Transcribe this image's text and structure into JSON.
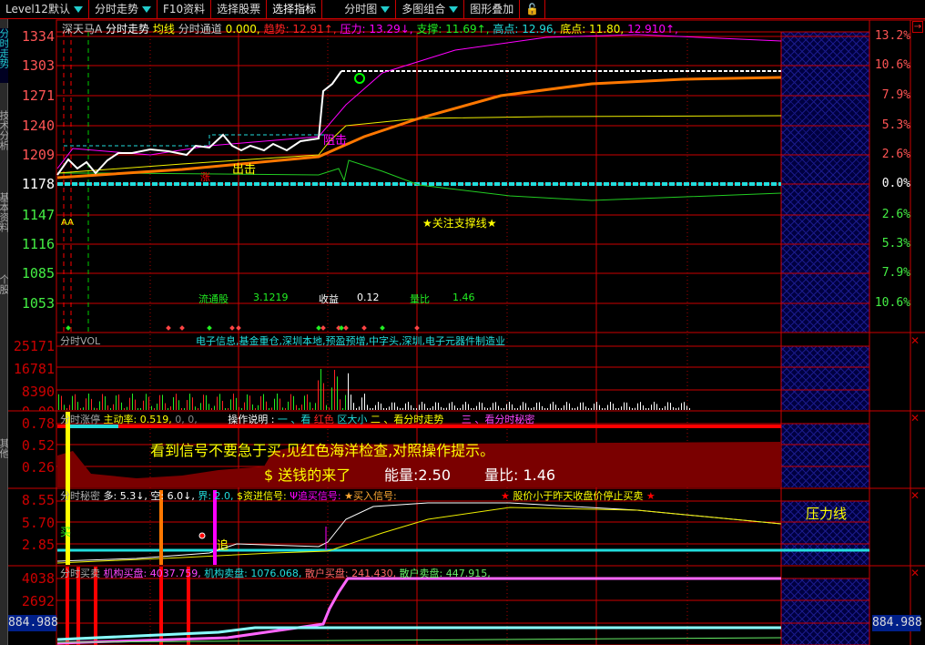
{
  "toolbar": {
    "items": [
      "Level12默认",
      "分时走势",
      "F10资料",
      "选择股票",
      "选择指标",
      "分时图",
      "多图组合",
      "图形叠加"
    ]
  },
  "sidebar": {
    "tabs": [
      "分时走势",
      "技术分析",
      "基本资料",
      "个股",
      "其他"
    ]
  },
  "main": {
    "stock": "深天马A",
    "mode": "分时走势",
    "ma": "均线",
    "channel_label": "分时通道",
    "channel_value": "0.000,",
    "trend": "趋势: 12.91↑,",
    "pressure": "压力: 13.29↓,",
    "support": "支撑: 11.69↑,",
    "high": "高点: 12.96,",
    "low": "底点: 11.80,",
    "extra": "12.910↑,",
    "left_axis": [
      "1334",
      "1303",
      "1271",
      "1240",
      "1209",
      "1178",
      "1147",
      "1116",
      "1085",
      "1053"
    ],
    "right_axis": [
      "13.2%",
      "10.6%",
      "7.9%",
      "5.3%",
      "2.6%",
      "0.0%",
      "2.6%",
      "5.3%",
      "7.9%",
      "10.6%"
    ],
    "labels": {
      "chuji": "出击",
      "zuji": "阻击",
      "zhang": "涨",
      "aa": "AA",
      "watch": "★关注支撑线★"
    },
    "stats": {
      "float_label": "流通股",
      "float_value": "3.1219",
      "eps_label": "收益",
      "eps_value": "0.12",
      "ratio_label": "量比",
      "ratio_value": "1.46"
    }
  },
  "vol": {
    "title": "分时VOL",
    "tags": "电子信息,基金重仓,深圳本地,预盈预增,中字头,深圳,电子元器件制造业",
    "axis": [
      "25171",
      "16781",
      "8390",
      "0.00"
    ]
  },
  "zt": {
    "title": "分时涨停",
    "active_rate": "主动率: 0.519,",
    "extra": "0, 0,",
    "guide_label": "操作说明 :",
    "g1": "一 、看",
    "g2": "红色",
    "g3": "区大小",
    "g4": "二 、看分时走势",
    "g5": "三 、看分时秘密",
    "axis": [
      "0.78",
      "0.52",
      "0.26"
    ],
    "msg1": "看到信号不要急于买,见红色海洋检查,对照操作提示。",
    "msg2": "$  送钱的来了",
    "energy": "能量:2.50",
    "ratio": "量比: 1.46"
  },
  "secret": {
    "title": "分时秘密",
    "duo": "多: 5.3↓,",
    "kong": "空: 6.0↓,",
    "jie": "界: 2.0,",
    "s1": "$资进信号:",
    "s2": "Ψ追买信号:",
    "s3": "★买入信号:",
    "warn": "股价小于昨天收盘价停止买卖",
    "axis": [
      "8.55",
      "5.70",
      "2.85"
    ],
    "buy": "买",
    "chase": "追",
    "pressure": "压力线"
  },
  "bs": {
    "title": "分时买卖",
    "inst_buy": "机构买盘: 4037.759,",
    "inst_sell": "机构卖盘: 1076.068,",
    "retail_buy": "散户买盘: 241.430,",
    "retail_sell": "散户卖盘: 447.915,",
    "axis": [
      "4038",
      "2692"
    ],
    "cursor_value": "884.988"
  }
}
